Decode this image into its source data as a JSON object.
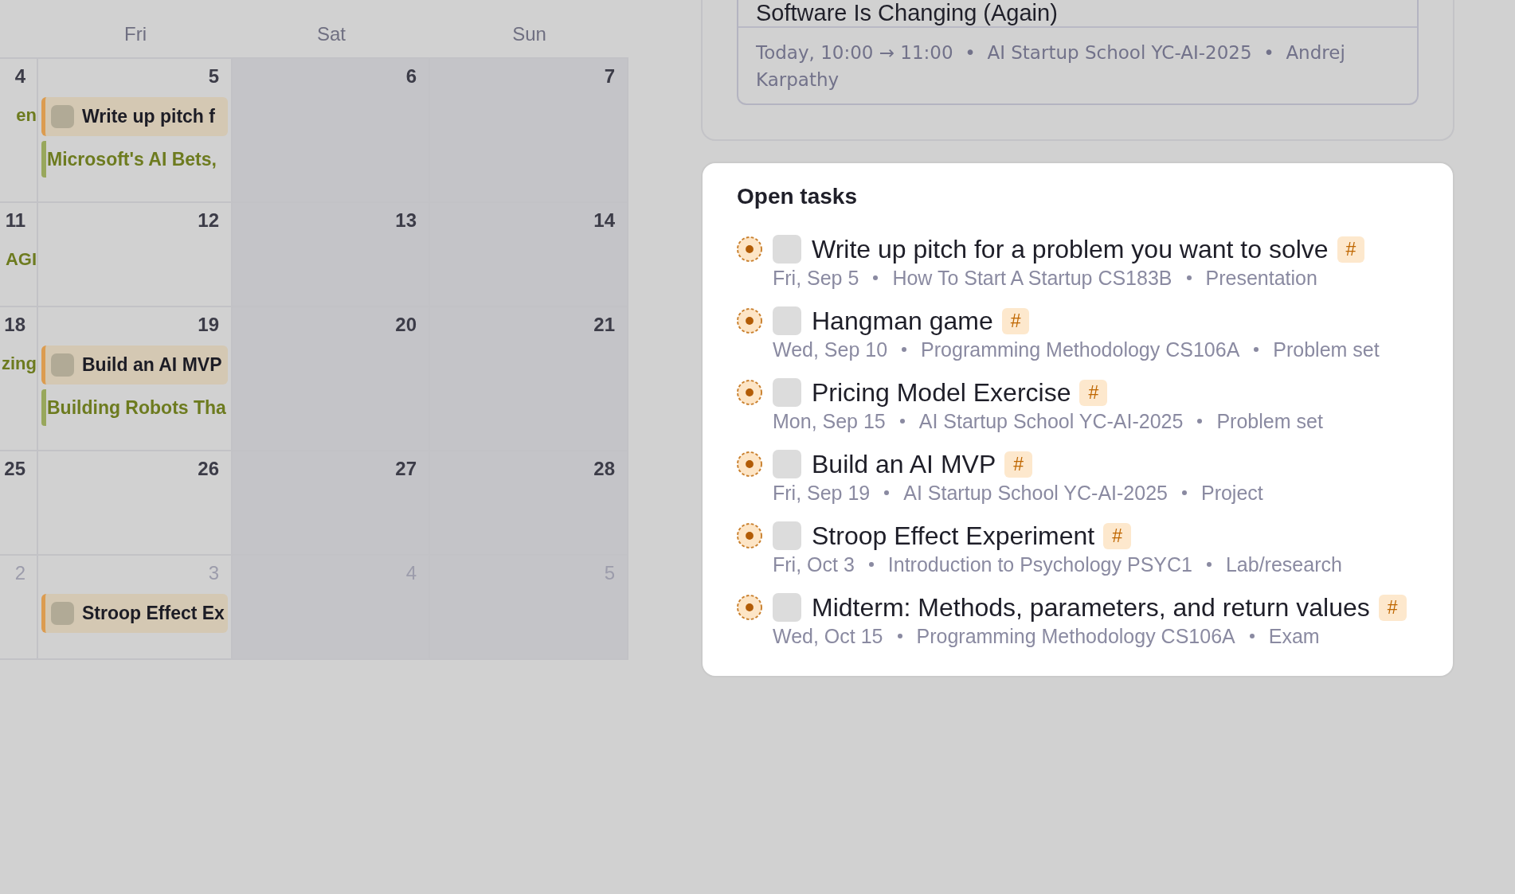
{
  "calendar": {
    "columns": [
      {
        "weekend": false
      },
      {
        "label": "Fri",
        "weekend": false
      },
      {
        "label": "Sat",
        "weekend": true
      },
      {
        "label": "Sun",
        "weekend": true
      }
    ],
    "weeks": [
      {
        "days": [
          {
            "day": "4",
            "other_month": false,
            "events": [
              {
                "kind": "event",
                "title": "en"
              }
            ]
          },
          {
            "day": "5",
            "other_month": false,
            "events": [
              {
                "kind": "task",
                "title": "Write up pitch f",
                "checked": false
              },
              {
                "kind": "event",
                "title": "Microsoft's AI Bets,"
              }
            ]
          },
          {
            "day": "6",
            "other_month": false
          },
          {
            "day": "7",
            "other_month": false
          }
        ]
      },
      {
        "days": [
          {
            "day": "11",
            "other_month": false,
            "events": [
              {
                "kind": "event",
                "title": "AGI"
              }
            ]
          },
          {
            "day": "12",
            "other_month": false
          },
          {
            "day": "13",
            "other_month": false
          },
          {
            "day": "14",
            "other_month": false
          }
        ]
      },
      {
        "days": [
          {
            "day": "18",
            "other_month": false,
            "events": [
              {
                "kind": "event",
                "title": "zing"
              }
            ]
          },
          {
            "day": "19",
            "other_month": false,
            "events": [
              {
                "kind": "task",
                "title": "Build an AI MVP",
                "checked": false
              },
              {
                "kind": "event",
                "title": "Building Robots Tha"
              }
            ]
          },
          {
            "day": "20",
            "other_month": false
          },
          {
            "day": "21",
            "other_month": false
          }
        ]
      },
      {
        "days": [
          {
            "day": "25",
            "other_month": false
          },
          {
            "day": "26",
            "other_month": false
          },
          {
            "day": "27",
            "other_month": false
          },
          {
            "day": "28",
            "other_month": false
          }
        ]
      },
      {
        "days": [
          {
            "day": "2",
            "other_month": true
          },
          {
            "day": "3",
            "other_month": true,
            "events": [
              {
                "kind": "task",
                "title": "Stroop Effect Ex",
                "checked": false
              }
            ]
          },
          {
            "day": "4",
            "other_month": true
          },
          {
            "day": "5",
            "other_month": true
          }
        ]
      }
    ]
  },
  "event_panel": {
    "card": {
      "title": "Software Is Changing (Again)",
      "details": "Today, 10:00 → 11:00  •  AI Startup School YC-AI-2025  •  Andrej Karpathy"
    }
  },
  "open_tasks": {
    "title": "Open tasks",
    "items": [
      {
        "title": "Write up pitch for a problem you want to solve",
        "tag": "#",
        "checked": false,
        "due": "Fri, Sep 5",
        "course": "How To Start A Startup CS183B",
        "type": "Presentation"
      },
      {
        "title": "Hangman game",
        "tag": "#",
        "checked": false,
        "due": "Wed, Sep 10",
        "course": "Programming Methodology CS106A",
        "type": "Problem set"
      },
      {
        "title": "Pricing Model Exercise",
        "tag": "#",
        "checked": false,
        "due": "Mon, Sep 15",
        "course": "AI Startup School YC-AI-2025",
        "type": "Problem set"
      },
      {
        "title": "Build an AI MVP",
        "tag": "#",
        "checked": false,
        "due": "Fri, Sep 19",
        "course": "AI Startup School YC-AI-2025",
        "type": "Project"
      },
      {
        "title": "Stroop Effect Experiment",
        "tag": "#",
        "checked": false,
        "due": "Fri, Oct 3",
        "course": "Introduction to Psychology PSYC1",
        "type": "Lab/research"
      },
      {
        "title": "Midterm: Methods, parameters, and return values",
        "tag": "#",
        "checked": false,
        "due": "Wed, Oct 15",
        "course": "Programming Methodology CS106A",
        "type": "Exam"
      }
    ]
  }
}
